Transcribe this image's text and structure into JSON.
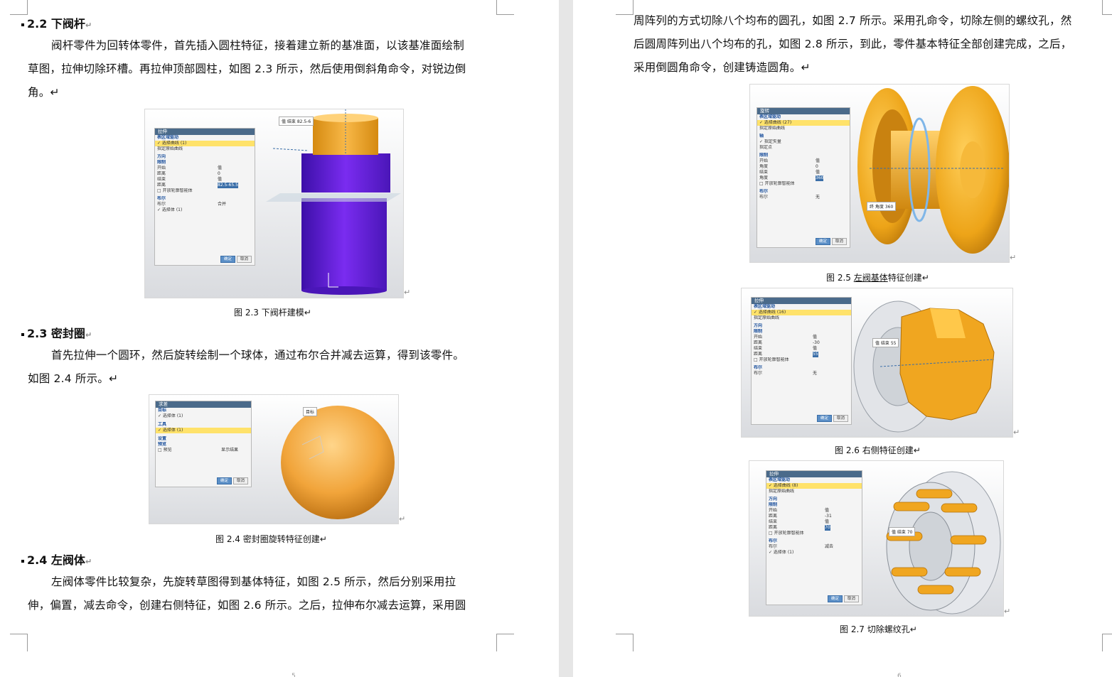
{
  "left_page": {
    "sections": [
      {
        "number": "2.2",
        "title": "下阀杆",
        "paragraph_lines": [
          "阀杆零件为回转体零件，首先插入圆柱特征，接着建立新的基准面，以该基准面绘制",
          "草图，拉伸切除环槽。再拉伸顶部圆柱，如图 2.3 所示，然后使用倒斜角命令，对锐边倒",
          "角。↵"
        ],
        "figure": {
          "caption": "图 2.3  下阀杆建模↵",
          "panel_title": "拉伸",
          "panel_rows": [
            "表区域驱动",
            "✓ 选择曲线 (1)",
            "指定原始曲线",
            "方向",
            "限制",
            "开始",
            "距离",
            "结束",
            "距离",
            "□ 开放轮廓智能体",
            "布尔",
            "布尔",
            "✓ 选择体 (1)"
          ],
          "panel_values": [
            "值",
            "0",
            "值",
            "82.5-65.5",
            "合并"
          ],
          "tag": "值  结束 82.5-6",
          "buttons": [
            "确定",
            "取消"
          ]
        }
      },
      {
        "number": "2.3",
        "title": "密封圈",
        "paragraph_lines": [
          "首先拉伸一个圆环，然后旋转绘制一个球体，通过布尔合并减去运算，得到该零件。",
          "如图 2.4 所示。↵"
        ],
        "figure": {
          "caption": "图 2.4  密封圈旋转特征创建↵",
          "panel_title": "求差",
          "panel_rows": [
            "目标",
            "✓ 选择体 (1)",
            "工具",
            "✓ 选择体 (1)",
            "设置",
            "预览",
            "□ 预览"
          ],
          "panel_extra": "显示结果",
          "tag": "目标",
          "buttons": [
            "确定",
            "取消"
          ]
        }
      },
      {
        "number": "2.4",
        "title": "左阀体",
        "paragraph_lines": [
          "左阀体零件比较复杂，先旋转草图得到基体特征，如图 2.5 所示，然后分别采用拉",
          "伸，偏置，减去命令，创建右侧特征，如图 2.6 所示。之后，拉伸布尔减去运算，采用圆"
        ]
      }
    ],
    "page_number": "5"
  },
  "right_page": {
    "paragraph_lines": [
      "周阵列的方式切除八个均布的圆孔，如图 2.7 所示。采用孔命令，切除左侧的螺纹孔，然",
      "后圆周阵列出八个均布的孔，如图 2.8 所示，到此，零件基本特征全部创建完成，之后，",
      "采用倒圆角命令，创建铸造圆角。↵"
    ],
    "figures": [
      {
        "caption_prefix": "图 2.5  ",
        "caption_link": "左阀基体",
        "caption_suffix": "特征创建↵",
        "panel_title": "旋转",
        "panel_rows": [
          "表区域驱动",
          "✓ 选择曲线 (27)",
          "指定原始曲线",
          "轴",
          "✓ 指定矢量",
          "指定点",
          "限制",
          "开始",
          "角度",
          "结束",
          "角度",
          "□ 开放轮廓智能体",
          "布尔",
          "布尔"
        ],
        "panel_values": [
          "值",
          "0",
          "值",
          "360",
          "无"
        ],
        "tag": "终  角度 360",
        "buttons": [
          "确定",
          "取消"
        ]
      },
      {
        "caption": "图 2.6  右侧特征创建↵",
        "panel_title": "拉伸",
        "panel_rows": [
          "表区域驱动",
          "✓ 选择曲线 (16)",
          "指定原始曲线",
          "方向",
          "限制",
          "开始",
          "距离",
          "结束",
          "距离",
          "□ 开放轮廓智能体",
          "布尔",
          "布尔"
        ],
        "panel_values": [
          "值",
          "-30",
          "值",
          "55",
          "无"
        ],
        "tag": "值  结束 55",
        "buttons": [
          "确定",
          "取消"
        ]
      },
      {
        "caption": "图 2.7  切除螺纹孔↵",
        "panel_title": "拉伸",
        "panel_rows": [
          "表区域驱动",
          "✓ 选择曲线 (8)",
          "指定原始曲线",
          "方向",
          "限制",
          "开始",
          "距离",
          "结束",
          "距离",
          "□ 开放轮廓智能体",
          "布尔",
          "布尔",
          "✓ 选择体 (1)"
        ],
        "panel_values": [
          "值",
          "-31",
          "值",
          "70",
          "减去"
        ],
        "tag": "值  结束 70",
        "buttons": [
          "确定",
          "取消"
        ]
      }
    ],
    "page_number": "6"
  },
  "colors": {
    "orange": "#f5a623",
    "purple": "#6a1fd6",
    "blue": "#2d7ad6",
    "panel_title": "#4a6a8a",
    "highlight": "#ffe26a"
  }
}
